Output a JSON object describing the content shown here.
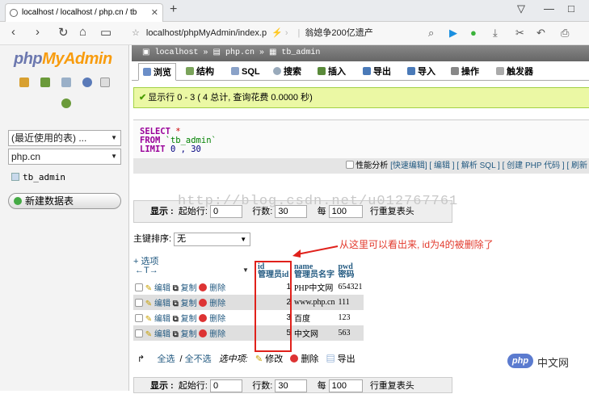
{
  "browser": {
    "tab_title": "localhost / localhost / php.cn / tb",
    "new_tab_icon": "plus-icon",
    "url": "localhost/phpMyAdmin/index.p",
    "suggestion": "翁媳争200亿遗产",
    "min_label": "—",
    "max_label": "□"
  },
  "sidebar": {
    "logo_php": "php",
    "logo_my": "MyAdmin",
    "recent_tables": "(最近使用的表) ...",
    "database": "php.cn",
    "table_item": "tb_admin",
    "new_table": "新建数据表"
  },
  "breadcrumb": {
    "server": "localhost",
    "db": "php.cn",
    "table": "tb_admin"
  },
  "tabs": [
    {
      "label": "浏览",
      "icon": "browse-icon",
      "color": "#6b8ec8"
    },
    {
      "label": "结构",
      "icon": "structure-icon",
      "color": "#7aa35a"
    },
    {
      "label": "SQL",
      "icon": "sql-icon",
      "color": "#8aa2c8"
    },
    {
      "label": "搜索",
      "icon": "search-icon",
      "color": "#9ab"
    },
    {
      "label": "插入",
      "icon": "insert-icon",
      "color": "#5a8a3a"
    },
    {
      "label": "导出",
      "icon": "export-icon",
      "color": "#4a7ab8"
    },
    {
      "label": "导入",
      "icon": "import-icon",
      "color": "#4a7ab8"
    },
    {
      "label": "操作",
      "icon": "wrench-icon",
      "color": "#888"
    },
    {
      "label": "触发器",
      "icon": "trigger-icon",
      "color": "#aaa"
    }
  ],
  "success": {
    "text": "显示行 0 - 3 ( 4 总计, 查询花费 0.0000 秒)"
  },
  "sql": {
    "select": "SELECT",
    "star": "*",
    "from": "FROM",
    "table": "`tb_admin`",
    "limit": "LIMIT",
    "limit_args": "0 , 30"
  },
  "sql_options": {
    "profiling": "性能分析",
    "links": "[快速编辑] [ 编辑 ] [ 解析 SQL ] [ 创建 PHP 代码 ] [ 刷新"
  },
  "navigation": {
    "show_label": "显示 :",
    "start_label": "起始行:",
    "start_value": "0",
    "rows_label": "行数:",
    "rows_value": "30",
    "every_label": "每",
    "every_value": "100",
    "repeat_label": "行重复表头"
  },
  "watermark": "http://blog.csdn.net/u012767761",
  "sort": {
    "label": "主键排序:",
    "value": "无"
  },
  "options_link": "+ 选项",
  "lr_arrows": "←T→",
  "columns": [
    {
      "name": "id",
      "comment": "管理员id"
    },
    {
      "name": "name",
      "comment": "管理员名字"
    },
    {
      "name": "pwd",
      "comment": "密码"
    }
  ],
  "row_actions": {
    "edit": "编辑",
    "copy": "复制",
    "delete": "删除"
  },
  "rows": [
    {
      "id": "1",
      "name": "PHP中文网",
      "pwd": "654321"
    },
    {
      "id": "2",
      "name": "www.php.cn",
      "pwd": "111"
    },
    {
      "id": "3",
      "name": "百度",
      "pwd": "123"
    },
    {
      "id": "5",
      "name": "中文网",
      "pwd": "563"
    }
  ],
  "annotation": "从这里可以看出来, id为4的被删除了",
  "bottom": {
    "check_all": "全选",
    "uncheck_all": "全不选",
    "selected": "选中项:",
    "modify": "修改",
    "delete": "删除",
    "export": "导出"
  },
  "brand": {
    "php": "php",
    "cn": "中文网"
  },
  "colors": {
    "pma_blue": "#6c78af",
    "pma_orange": "#f89c0e",
    "success_bg": "#ebf8a4",
    "annotation_red": "#e23b2e"
  }
}
